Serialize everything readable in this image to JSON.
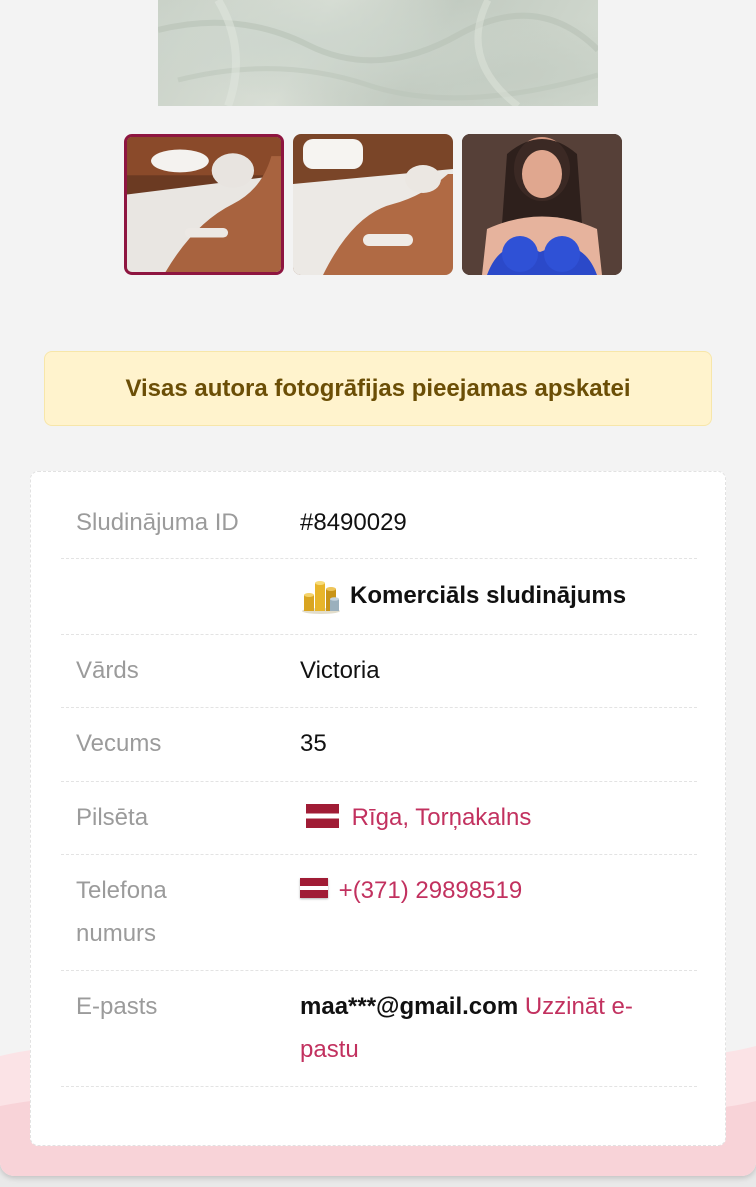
{
  "notice": {
    "text": "Visas autora fotogrāfijas pieejamas apskatei"
  },
  "details": {
    "ad_id": {
      "label": "Sludinājuma ID",
      "value": "#8490029"
    },
    "commercial": {
      "icon": "coins-stack-icon",
      "text": "Komerciāls sludinājums"
    },
    "name": {
      "label": "Vārds",
      "value": "Victoria"
    },
    "age": {
      "label": "Vecums",
      "value": "35"
    },
    "city": {
      "label": "Pilsēta",
      "icon": "latvia-flag-icon",
      "value": "Rīga, Torņakalns"
    },
    "phone": {
      "label_line1": "Telefona",
      "label_line2": "numurs",
      "icon": "latvia-flag-icon",
      "value": "+(371) 29898519"
    },
    "email": {
      "label": "E-pasts",
      "value": "maa***@gmail.com",
      "link_line1": "Uzzināt e-",
      "link_line2": "pastu"
    }
  },
  "colors": {
    "accent": "#c2315f",
    "active_thumb_border": "#8e1540",
    "notice_bg": "#fff3cd",
    "notice_text": "#6b4e06"
  }
}
